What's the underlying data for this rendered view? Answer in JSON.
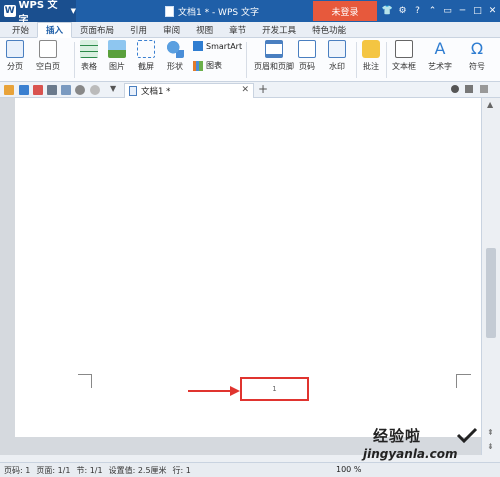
{
  "app": {
    "name": "WPS 文字"
  },
  "window": {
    "title": "文档1 * - WPS 文字",
    "login": "未登录"
  },
  "tabs": [
    "开始",
    "插入",
    "页面布局",
    "引用",
    "审阅",
    "视图",
    "章节",
    "开发工具",
    "特色功能"
  ],
  "active_tab": "插入",
  "ribbon": {
    "page_break": "分页",
    "blank_page": "空白页",
    "table": "表格",
    "picture": "图片",
    "screenshot": "截屏",
    "shapes": "形状",
    "smartart": "SmartArt",
    "chart": "图表",
    "header_footer": "页眉和页脚",
    "page_number": "页码",
    "watermark": "水印",
    "comment": "批注",
    "textbox": "文本框",
    "wordart": "艺术字",
    "symbol": "符号"
  },
  "document_tab": "文档1 *",
  "page": {
    "footer_number": "1"
  },
  "status": {
    "page_index": "页码: 1",
    "pages": "页面: 1/1",
    "section": "节: 1/1",
    "position": "设置值: 2.5厘米",
    "line": "行: 1",
    "zoom": "100 %"
  },
  "watermark": {
    "line1": "经验啦",
    "line2": "jingyanla.com"
  },
  "colors": {
    "title_bar": "#1f5fa8",
    "login": "#e7593c",
    "highlight_box": "#e0342f"
  }
}
